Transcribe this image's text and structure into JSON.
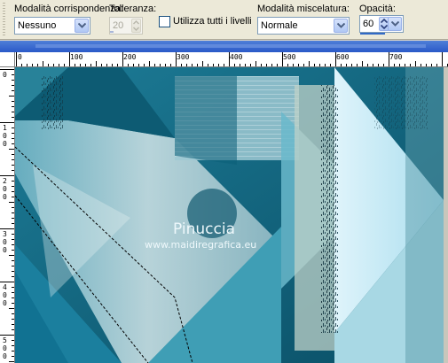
{
  "toolbar": {
    "match_mode": {
      "label": "Modalità corrispondenza:",
      "value": "Nessuno"
    },
    "tolerance": {
      "label": "Tolleranza:",
      "value": "20",
      "disabled": true
    },
    "all_layers": {
      "label": "Utilizza tutti i livelli",
      "checked": false
    },
    "blend_mode": {
      "label": "Modalità miscelatura:",
      "value": "Normale"
    },
    "opacity": {
      "label": "Opacità:",
      "value": "60"
    }
  },
  "ruler": {
    "horizontal_labels": [
      "0",
      "100",
      "200",
      "300",
      "400",
      "500",
      "600",
      "700"
    ],
    "vertical_labels": [
      "0",
      "1\n0\n0",
      "2\n0\n0",
      "3\n0\n0",
      "4\n0\n0",
      "5\n0\n0"
    ]
  },
  "watermark": {
    "name": "Pinuccia",
    "site": "www.maidiregrafica.eu"
  },
  "colors": {
    "accent": "#3169c6",
    "teal_dark": "#0e5f77",
    "teal_mid": "#3a98b0",
    "cyan_light": "#bfe9f6",
    "selection": "#000000"
  },
  "icons": {
    "combo_button": "chevron-down-icon",
    "spinner": "spin-up-down-icon"
  }
}
